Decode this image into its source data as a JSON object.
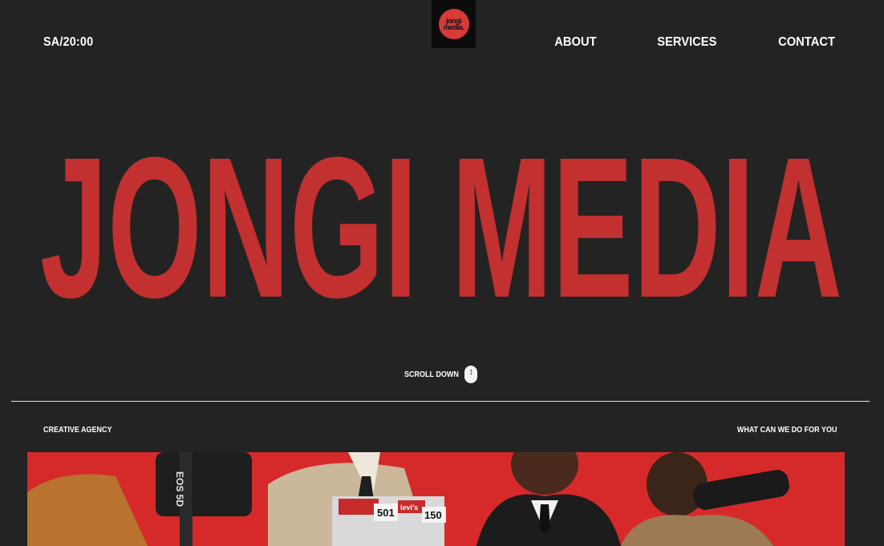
{
  "header": {
    "time": "SA/20:00",
    "logo_line1": "jongi",
    "logo_line2": "media."
  },
  "nav": {
    "items": [
      "ABOUT",
      "SERVICES",
      "CONTACT"
    ]
  },
  "hero": {
    "title": "JONGI MEDIA",
    "color": "#c23030"
  },
  "scroll": {
    "label": "SCROLL DOWN"
  },
  "section": {
    "left_label": "CREATIVE AGENCY",
    "right_label": "WHAT CAN WE DO FOR YOU"
  },
  "photo": {
    "background": "#d62a2a",
    "sticker_1": "501",
    "sticker_2": "levi's",
    "sticker_3": "150",
    "camera_text": "EOS 5D"
  }
}
